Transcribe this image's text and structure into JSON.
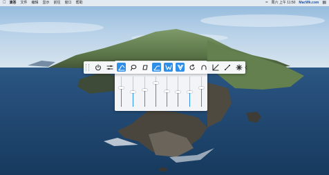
{
  "menubar": {
    "app_name": "滴答",
    "items": [
      "文件",
      "编辑",
      "显示",
      "前往",
      "窗口",
      "帮助"
    ],
    "clock": "周六 上午 11:50",
    "brand": "MacWk.com",
    "icons": [
      "apple-icon",
      "wifi-icon",
      "control-center-icon"
    ]
  },
  "toolbar": {
    "tools": [
      {
        "name": "power",
        "icon": "power-icon",
        "active": false
      },
      {
        "name": "equalizer",
        "icon": "sliders-icon",
        "active": false
      },
      {
        "name": "curve",
        "icon": "curve-icon",
        "active": true
      },
      {
        "name": "lasso",
        "icon": "lasso-icon",
        "active": false
      },
      {
        "name": "shape",
        "icon": "shape-icon",
        "active": false
      },
      {
        "name": "highpass",
        "icon": "highpass-icon",
        "active": true
      },
      {
        "name": "bandpass",
        "icon": "bandpass-icon",
        "active": true
      },
      {
        "name": "filter",
        "icon": "filter-icon",
        "active": true
      },
      {
        "name": "loop",
        "icon": "loop-icon",
        "active": false
      },
      {
        "name": "arch",
        "icon": "arch-icon",
        "active": false
      },
      {
        "name": "ramp",
        "icon": "ramp-icon",
        "active": false
      },
      {
        "name": "link",
        "icon": "link-icon",
        "active": false
      },
      {
        "name": "spark",
        "icon": "spark-icon",
        "active": false
      },
      {
        "name": "collapse",
        "icon": "chevron-left-icon",
        "active": false
      }
    ]
  },
  "sliders": [
    {
      "level": 0.62
    },
    {
      "level": 0.5
    },
    {
      "level": 0.55
    },
    {
      "level": 0.78
    },
    {
      "level": 0.52
    },
    {
      "level": 0.5
    },
    {
      "level": 0.48
    },
    {
      "level": 0.62
    }
  ],
  "colors": {
    "accent": "#2f8fe8",
    "panel": "#fafafc"
  }
}
